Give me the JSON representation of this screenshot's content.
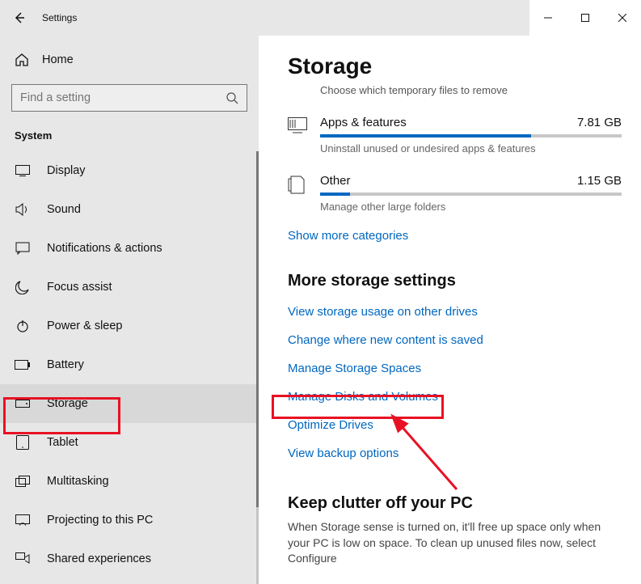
{
  "titlebar": {
    "title": "Settings"
  },
  "sidebar": {
    "home_label": "Home",
    "search_placeholder": "Find a setting",
    "section": "System",
    "items": [
      {
        "label": "Display"
      },
      {
        "label": "Sound"
      },
      {
        "label": "Notifications & actions"
      },
      {
        "label": "Focus assist"
      },
      {
        "label": "Power & sleep"
      },
      {
        "label": "Battery"
      },
      {
        "label": "Storage"
      },
      {
        "label": "Tablet"
      },
      {
        "label": "Multitasking"
      },
      {
        "label": "Projecting to this PC"
      },
      {
        "label": "Shared experiences"
      }
    ]
  },
  "main": {
    "title": "Storage",
    "subtitle": "Choose which temporary files to remove",
    "categories": [
      {
        "name": "Apps & features",
        "size": "7.81 GB",
        "fill_pct": 70,
        "desc": "Uninstall unused or undesired apps & features"
      },
      {
        "name": "Other",
        "size": "1.15 GB",
        "fill_pct": 10,
        "desc": "Manage other large folders"
      }
    ],
    "show_more": "Show more categories",
    "more_settings_title": "More storage settings",
    "links": [
      "View storage usage on other drives",
      "Change where new content is saved",
      "Manage Storage Spaces",
      "Manage Disks and Volumes",
      "Optimize Drives",
      "View backup options"
    ],
    "keep_title": "Keep clutter off your PC",
    "keep_desc": "When Storage sense is turned on, it'll free up space only when your PC is low on space. To clean up unused files now, select Configure"
  }
}
